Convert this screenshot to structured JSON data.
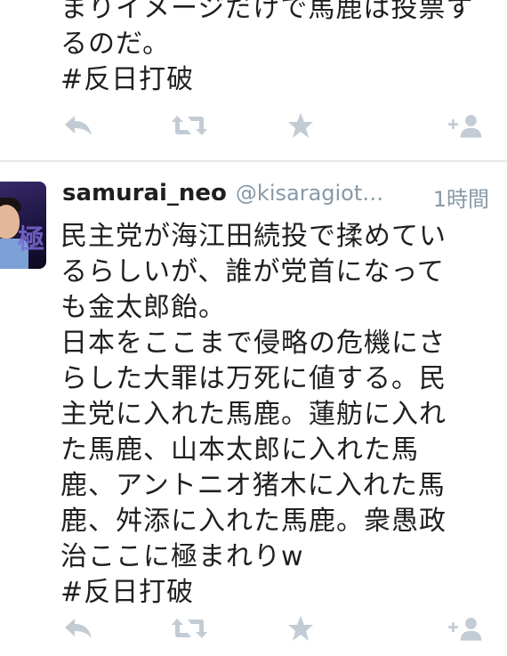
{
  "tweet_top": {
    "text": "まりイメージだけで馬鹿は投票す\nるのだ。\n#反日打破"
  },
  "tweet_main": {
    "name": "samurai_neo",
    "handle": "@kisaragiot…",
    "time": "1時間",
    "text": "民主党が海江田続投で揉めてい\nるらしいが、誰が党首になって\nも金太郎飴。\n日本をここまで侵略の危機にさ\nらした大罪は万死に値する。民\n主党に入れた馬鹿。蓮舫に入れ\nた馬鹿、山本太郎に入れた馬\n鹿、アントニオ猪木に入れた馬\n鹿、舛添に入れた馬鹿。衆愚政\n治ここに極まれりw\n#反日打破"
  },
  "avatar": {
    "kanji": "極"
  },
  "colors": {
    "icon_gray": "#c3ccd4",
    "meta_gray": "#8899a6",
    "text": "#1f1f1f",
    "divider": "#e6e6e6"
  },
  "actions": [
    "reply-icon",
    "retweet-icon",
    "favorite-icon",
    "follow-icon"
  ]
}
